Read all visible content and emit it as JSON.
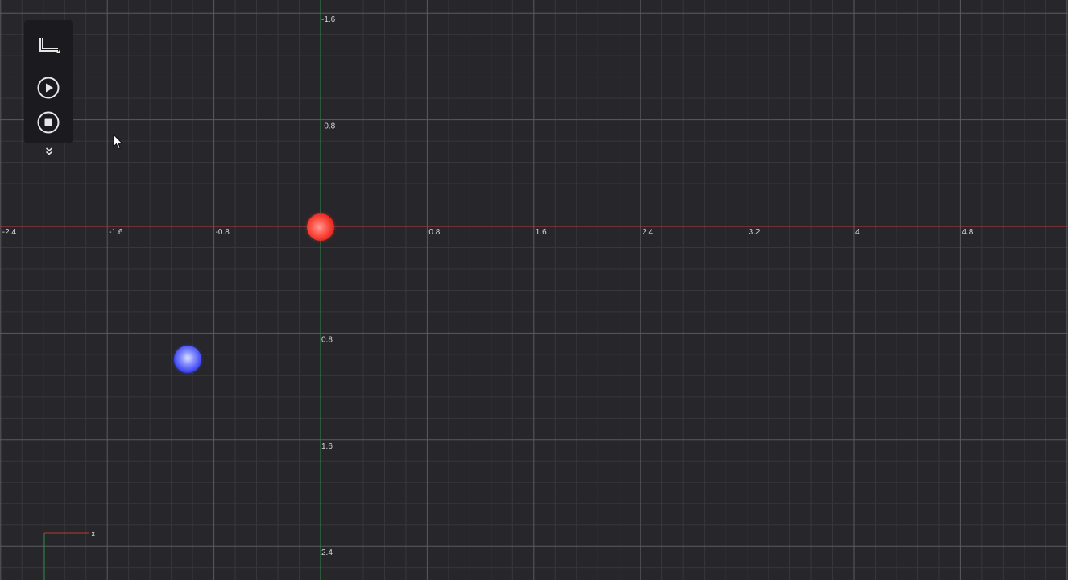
{
  "toolbar": {
    "items": [
      {
        "icon": "axes-mode-icon"
      },
      {
        "icon": "play-icon"
      },
      {
        "icon": "stop-icon"
      }
    ],
    "expand_icon": "double-chevron-down-icon"
  },
  "grid": {
    "x_tick_labels": [
      "-2.4",
      "-1.6",
      "-0.8",
      "0.8",
      "1.6",
      "2.4",
      "3.2",
      "4",
      "4.8"
    ],
    "y_tick_labels": [
      "-1.6",
      "-0.8",
      "0.8",
      "1.6",
      "2.4"
    ],
    "x_axis_color": "#b83a3a",
    "y_axis_color": "#2e8a4a",
    "major_line_color": "#5a5a60",
    "minor_line_color": "#38373d",
    "background_color": "#27262b"
  },
  "bodies": [
    {
      "name": "red",
      "color": "#ff4a3f",
      "x": 0.0,
      "y": 0.0
    },
    {
      "name": "blue",
      "color": "#4a52ff",
      "x": -1.0,
      "y": 1.0
    }
  ],
  "axis_gizmo": {
    "x_label": "x"
  }
}
